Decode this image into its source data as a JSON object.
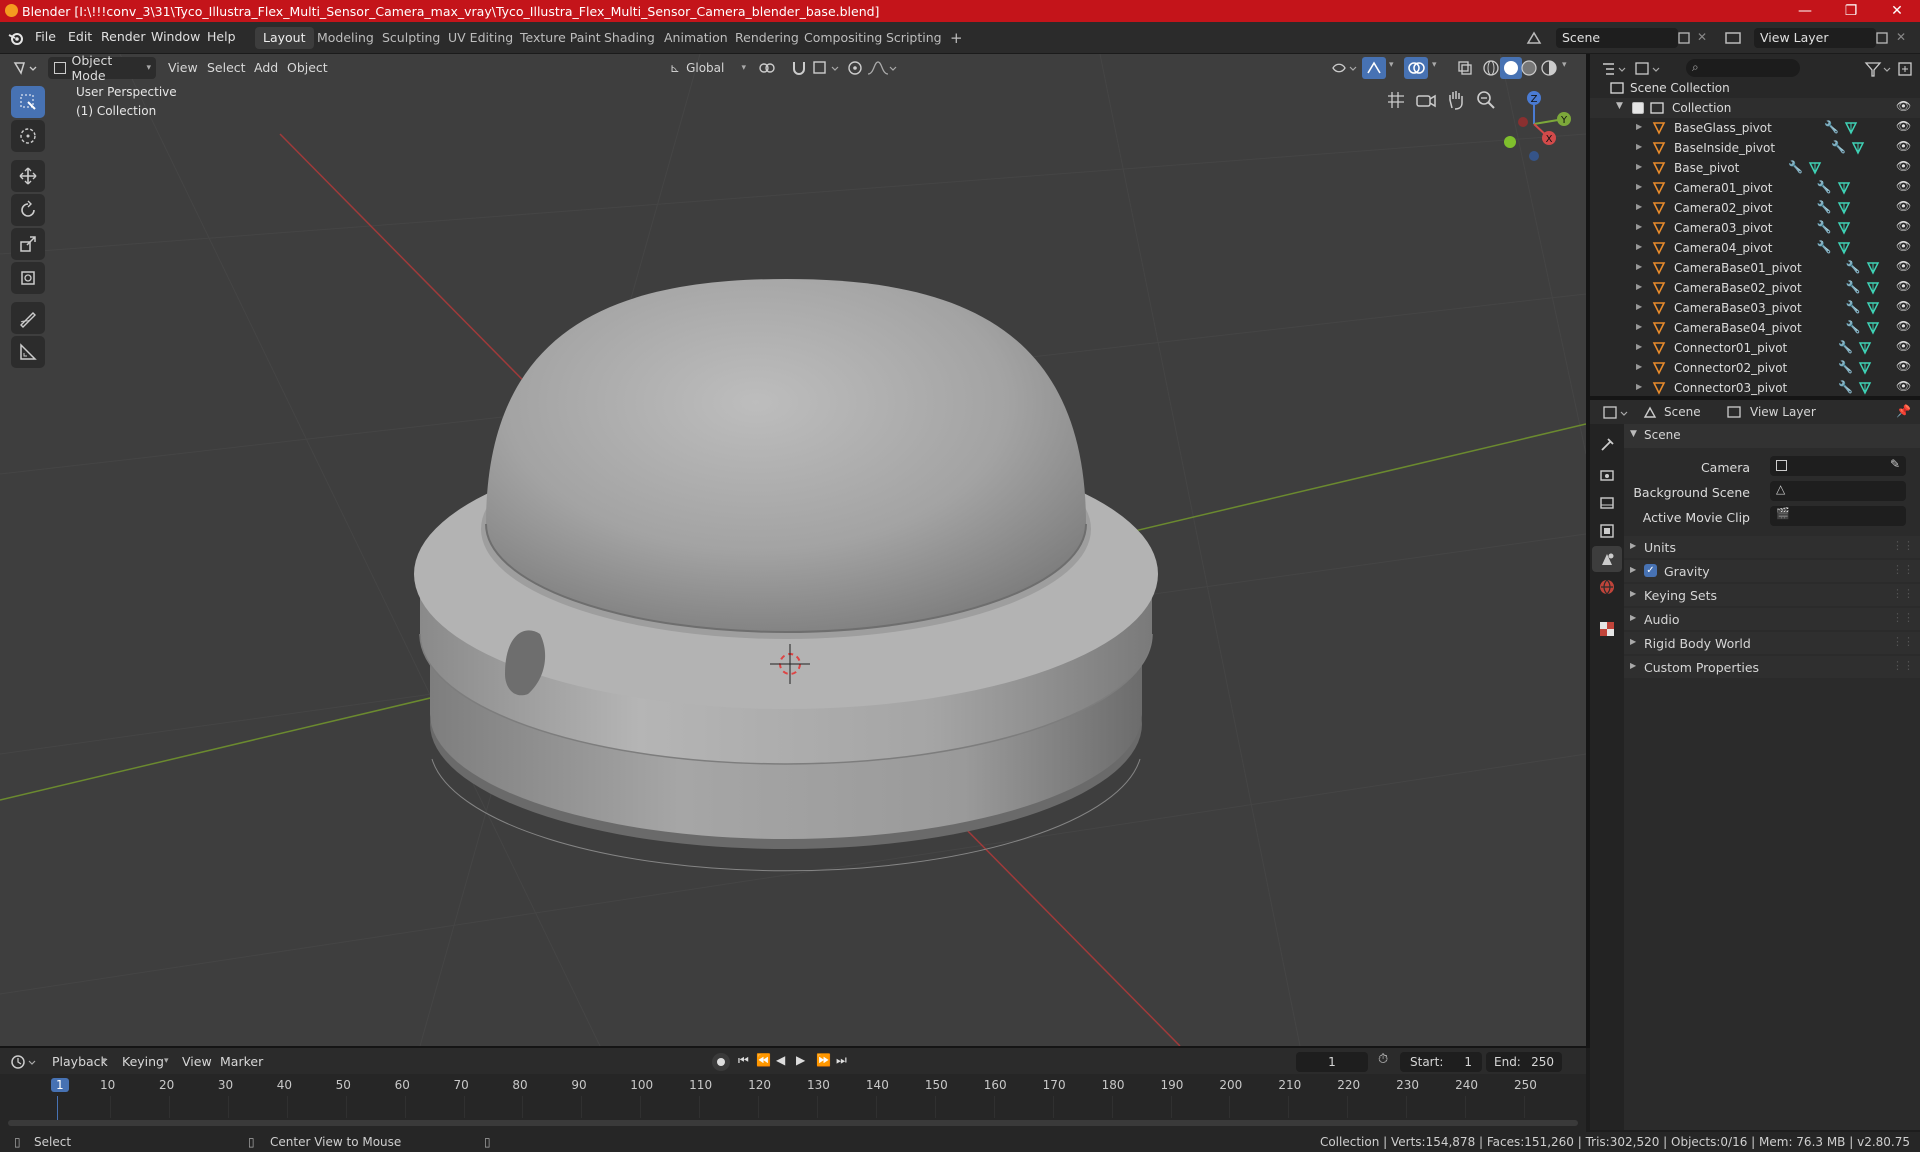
{
  "window": {
    "title": "Blender [I:\\!!!conv_3\\31\\Tyco_Illustra_Flex_Multi_Sensor_Camera_max_vray\\Tyco_Illustra_Flex_Multi_Sensor_Camera_blender_base.blend]",
    "controls": [
      "—",
      "❐",
      "✕"
    ]
  },
  "menubar": {
    "items": [
      "File",
      "Edit",
      "Render",
      "Window",
      "Help"
    ],
    "workspaces": [
      "Layout",
      "Modeling",
      "Sculpting",
      "UV Editing",
      "Texture Paint",
      "Shading",
      "Animation",
      "Rendering",
      "Compositing",
      "Scripting",
      "+"
    ],
    "active_workspace": "Layout",
    "scene": "Scene",
    "view_layer": "View Layer"
  },
  "viewport": {
    "mode": "Object Mode",
    "menus": [
      "View",
      "Select",
      "Add",
      "Object"
    ],
    "transform_orientation": "Global",
    "perspective_label": "User Perspective",
    "collection_label": "(1) Collection",
    "axes": {
      "x": "X",
      "y": "Y",
      "z": "Z"
    }
  },
  "outliner": {
    "root": "Scene Collection",
    "collection": "Collection",
    "items": [
      "BaseGlass_pivot",
      "BaseInside_pivot",
      "Base_pivot",
      "Camera01_pivot",
      "Camera02_pivot",
      "Camera03_pivot",
      "Camera04_pivot",
      "CameraBase01_pivot",
      "CameraBase02_pivot",
      "CameraBase03_pivot",
      "CameraBase04_pivot",
      "Connector01_pivot",
      "Connector02_pivot",
      "Connector03_pivot"
    ]
  },
  "properties": {
    "breadcrumb_scene": "Scene",
    "breadcrumb_viewlayer": "View Layer",
    "section": "Scene",
    "fields": [
      {
        "label": "Camera",
        "value": ""
      },
      {
        "label": "Background Scene",
        "value": ""
      },
      {
        "label": "Active Movie Clip",
        "value": ""
      }
    ],
    "panels": [
      "Units",
      "Gravity",
      "Keying Sets",
      "Audio",
      "Rigid Body World",
      "Custom Properties"
    ],
    "gravity_checked": true
  },
  "timeline": {
    "menus": [
      "Playback",
      "Keying",
      "View",
      "Marker"
    ],
    "current_frame": "1",
    "start_label": "Start:",
    "start": "1",
    "end_label": "End:",
    "end": "250",
    "ticks": [
      "1",
      "10",
      "20",
      "30",
      "40",
      "50",
      "60",
      "70",
      "80",
      "90",
      "100",
      "110",
      "120",
      "130",
      "140",
      "150",
      "160",
      "170",
      "180",
      "190",
      "200",
      "210",
      "220",
      "230",
      "240",
      "250"
    ]
  },
  "statusbar": {
    "select": "Select",
    "center": "Center View to Mouse",
    "stats": "Collection | Verts:154,878 | Faces:151,260 | Tris:302,520 | Objects:0/16 | Mem: 76.3 MB | v2.80.75"
  },
  "colors": {
    "titlebar": "#c4141a",
    "accent": "#4772b3",
    "object_icon": "#e88b2c",
    "modifier_icon": "#6aa6f5",
    "mesh_icon": "#3fd1b5"
  }
}
